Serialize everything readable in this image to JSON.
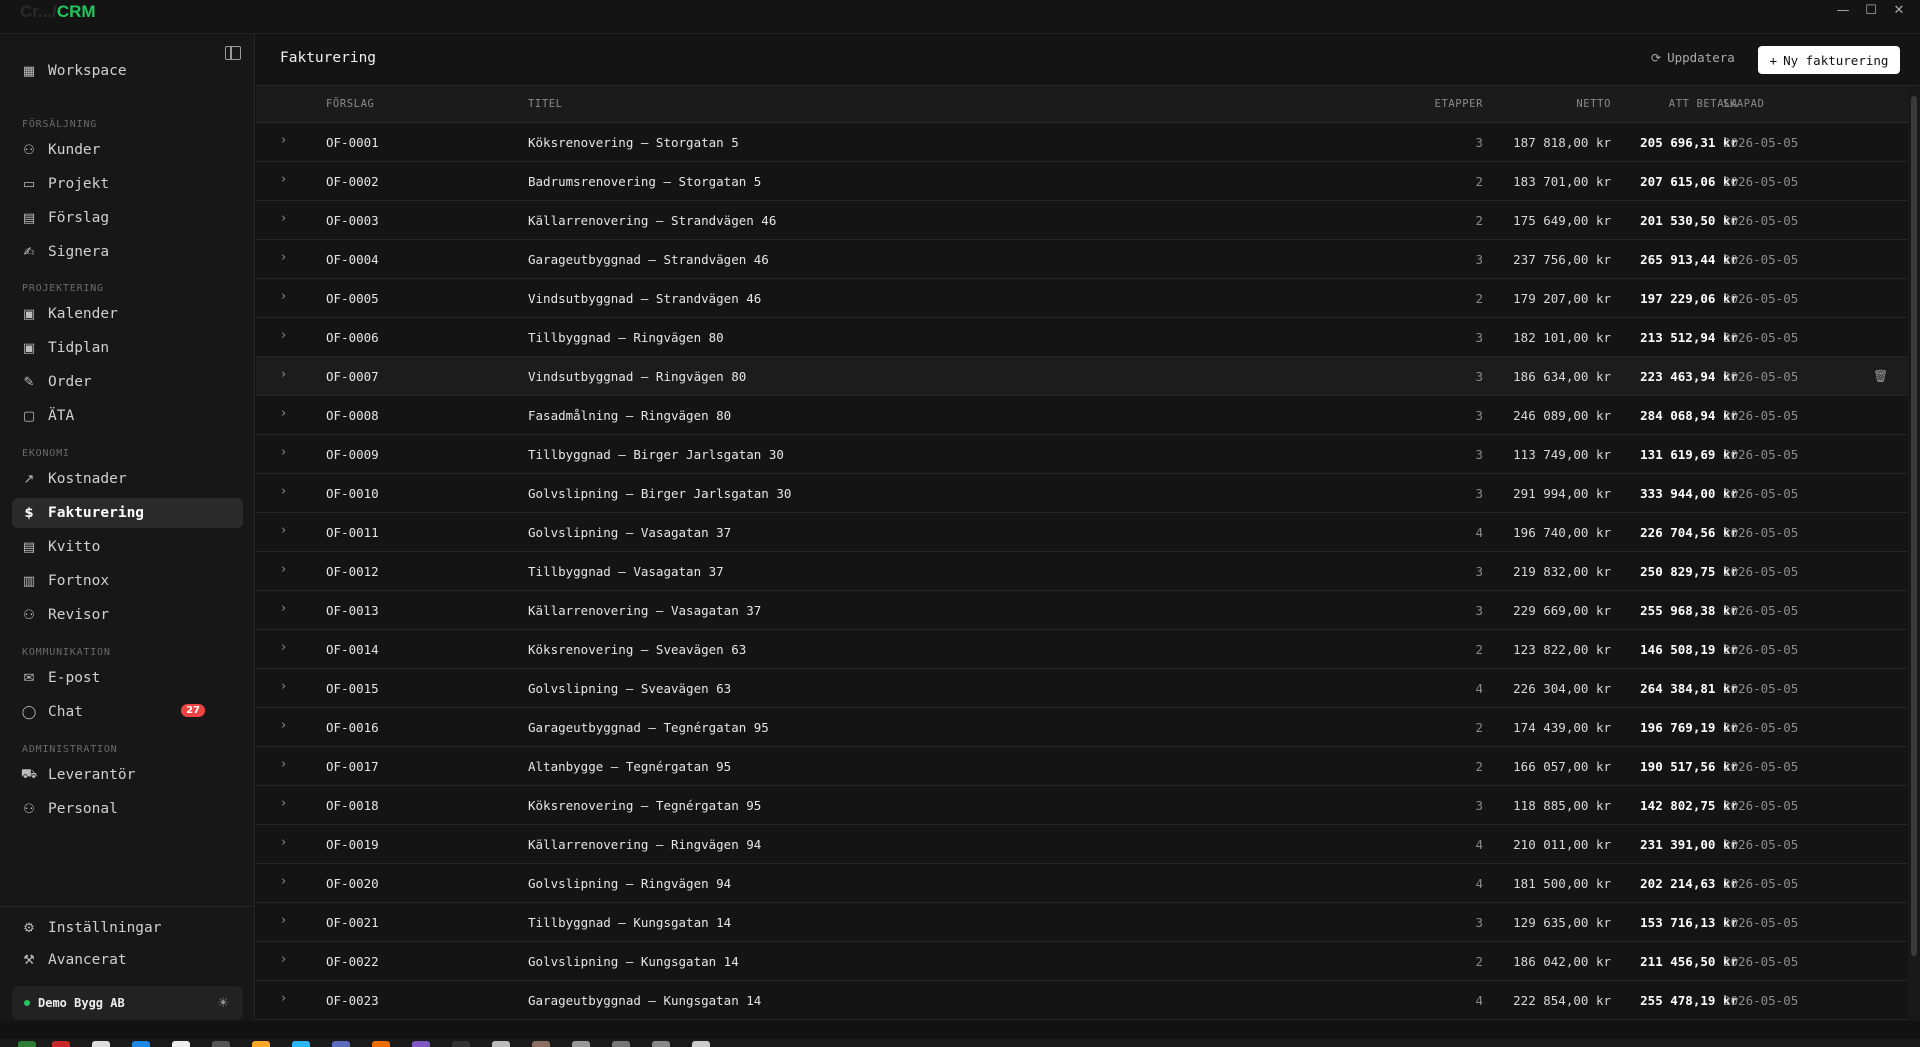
{
  "app": {
    "brand_prefix": "Cr.../",
    "brand_suffix": "CRM"
  },
  "window_controls": {
    "minimize": "—",
    "maximize": "☐",
    "close": "✕"
  },
  "sidebar": {
    "workspace": "Workspace",
    "sections": {
      "forsaljning": "FÖRSÄLJNING",
      "projektering": "PROJEKTERING",
      "ekonomi": "EKONOMI",
      "kommunikation": "KOMMUNIKATION",
      "administration": "ADMINISTRATION"
    },
    "items": {
      "kunder": "Kunder",
      "projekt": "Projekt",
      "forslag": "Förslag",
      "signera": "Signera",
      "kalender": "Kalender",
      "tidplan": "Tidplan",
      "order": "Order",
      "ata": "ÄTA",
      "kostnader": "Kostnader",
      "fakturering": "Fakturering",
      "kvitto": "Kvitto",
      "fortnox": "Fortnox",
      "revisor": "Revisor",
      "epost": "E-post",
      "chat": "Chat",
      "leverantor": "Leverantör",
      "personal": "Personal",
      "installningar": "Inställningar",
      "avancerat": "Avancerat"
    },
    "chat_badge": "27",
    "company": "Demo Bygg AB",
    "active": "fakturering"
  },
  "header": {
    "title": "Fakturering",
    "refresh_label": "Uppdatera",
    "new_label": "Ny fakturering"
  },
  "table": {
    "columns": {
      "forslag": "FÖRSLAG",
      "titel": "TITEL",
      "etapper": "ETAPPER",
      "netto": "NETTO",
      "att_betala": "ATT BETALA",
      "skapad": "SKAPAD"
    },
    "rows": [
      {
        "id": "OF-0001",
        "title": "Köksrenovering — Storgatan 5",
        "etapper": "3",
        "netto": "187 818,00 kr",
        "att": "205 696,31 kr",
        "date": "2026-05-05"
      },
      {
        "id": "OF-0002",
        "title": "Badrumsrenovering — Storgatan 5",
        "etapper": "2",
        "netto": "183 701,00 kr",
        "att": "207 615,06 kr",
        "date": "2026-05-05"
      },
      {
        "id": "OF-0003",
        "title": "Källarrenovering — Strandvägen 46",
        "etapper": "2",
        "netto": "175 649,00 kr",
        "att": "201 530,50 kr",
        "date": "2026-05-05"
      },
      {
        "id": "OF-0004",
        "title": "Garageutbyggnad — Strandvägen 46",
        "etapper": "3",
        "netto": "237 756,00 kr",
        "att": "265 913,44 kr",
        "date": "2026-05-05"
      },
      {
        "id": "OF-0005",
        "title": "Vindsutbyggnad — Strandvägen 46",
        "etapper": "2",
        "netto": "179 207,00 kr",
        "att": "197 229,06 kr",
        "date": "2026-05-05"
      },
      {
        "id": "OF-0006",
        "title": "Tillbyggnad — Ringvägen 80",
        "etapper": "3",
        "netto": "182 101,00 kr",
        "att": "213 512,94 kr",
        "date": "2026-05-05"
      },
      {
        "id": "OF-0007",
        "title": "Vindsutbyggnad — Ringvägen 80",
        "etapper": "3",
        "netto": "186 634,00 kr",
        "att": "223 463,94 kr",
        "date": "2026-05-05"
      },
      {
        "id": "OF-0008",
        "title": "Fasadmålning — Ringvägen 80",
        "etapper": "3",
        "netto": "246 089,00 kr",
        "att": "284 068,94 kr",
        "date": "2026-05-05"
      },
      {
        "id": "OF-0009",
        "title": "Tillbyggnad — Birger Jarlsgatan 30",
        "etapper": "3",
        "netto": "113 749,00 kr",
        "att": "131 619,69 kr",
        "date": "2026-05-05"
      },
      {
        "id": "OF-0010",
        "title": "Golvslipning — Birger Jarlsgatan 30",
        "etapper": "3",
        "netto": "291 994,00 kr",
        "att": "333 944,00 kr",
        "date": "2026-05-05"
      },
      {
        "id": "OF-0011",
        "title": "Golvslipning — Vasagatan 37",
        "etapper": "4",
        "netto": "196 740,00 kr",
        "att": "226 704,56 kr",
        "date": "2026-05-05"
      },
      {
        "id": "OF-0012",
        "title": "Tillbyggnad — Vasagatan 37",
        "etapper": "3",
        "netto": "219 832,00 kr",
        "att": "250 829,75 kr",
        "date": "2026-05-05"
      },
      {
        "id": "OF-0013",
        "title": "Källarrenovering — Vasagatan 37",
        "etapper": "3",
        "netto": "229 669,00 kr",
        "att": "255 968,38 kr",
        "date": "2026-05-05"
      },
      {
        "id": "OF-0014",
        "title": "Köksrenovering — Sveavägen 63",
        "etapper": "2",
        "netto": "123 822,00 kr",
        "att": "146 508,19 kr",
        "date": "2026-05-05"
      },
      {
        "id": "OF-0015",
        "title": "Golvslipning — Sveavägen 63",
        "etapper": "4",
        "netto": "226 304,00 kr",
        "att": "264 384,81 kr",
        "date": "2026-05-05"
      },
      {
        "id": "OF-0016",
        "title": "Garageutbyggnad — Tegnérgatan 95",
        "etapper": "2",
        "netto": "174 439,00 kr",
        "att": "196 769,19 kr",
        "date": "2026-05-05"
      },
      {
        "id": "OF-0017",
        "title": "Altanbygge — Tegnérgatan 95",
        "etapper": "2",
        "netto": "166 057,00 kr",
        "att": "190 517,56 kr",
        "date": "2026-05-05"
      },
      {
        "id": "OF-0018",
        "title": "Köksrenovering — Tegnérgatan 95",
        "etapper": "3",
        "netto": "118 885,00 kr",
        "att": "142 802,75 kr",
        "date": "2026-05-05"
      },
      {
        "id": "OF-0019",
        "title": "Källarrenovering — Ringvägen 94",
        "etapper": "4",
        "netto": "210 011,00 kr",
        "att": "231 391,00 kr",
        "date": "2026-05-05"
      },
      {
        "id": "OF-0020",
        "title": "Golvslipning — Ringvägen 94",
        "etapper": "4",
        "netto": "181 500,00 kr",
        "att": "202 214,63 kr",
        "date": "2026-05-05"
      },
      {
        "id": "OF-0021",
        "title": "Tillbyggnad — Kungsgatan 14",
        "etapper": "3",
        "netto": "129 635,00 kr",
        "att": "153 716,13 kr",
        "date": "2026-05-05"
      },
      {
        "id": "OF-0022",
        "title": "Golvslipning — Kungsgatan 14",
        "etapper": "2",
        "netto": "186 042,00 kr",
        "att": "211 456,50 kr",
        "date": "2026-05-05"
      },
      {
        "id": "OF-0023",
        "title": "Garageutbyggnad — Kungsgatan 14",
        "etapper": "4",
        "netto": "222 854,00 kr",
        "att": "255 478,19 kr",
        "date": "2026-05-05"
      }
    ],
    "hovered_row": 6
  },
  "colors": {
    "accent": "#22c55e",
    "badge": "#ef4444",
    "background": "#121212"
  }
}
